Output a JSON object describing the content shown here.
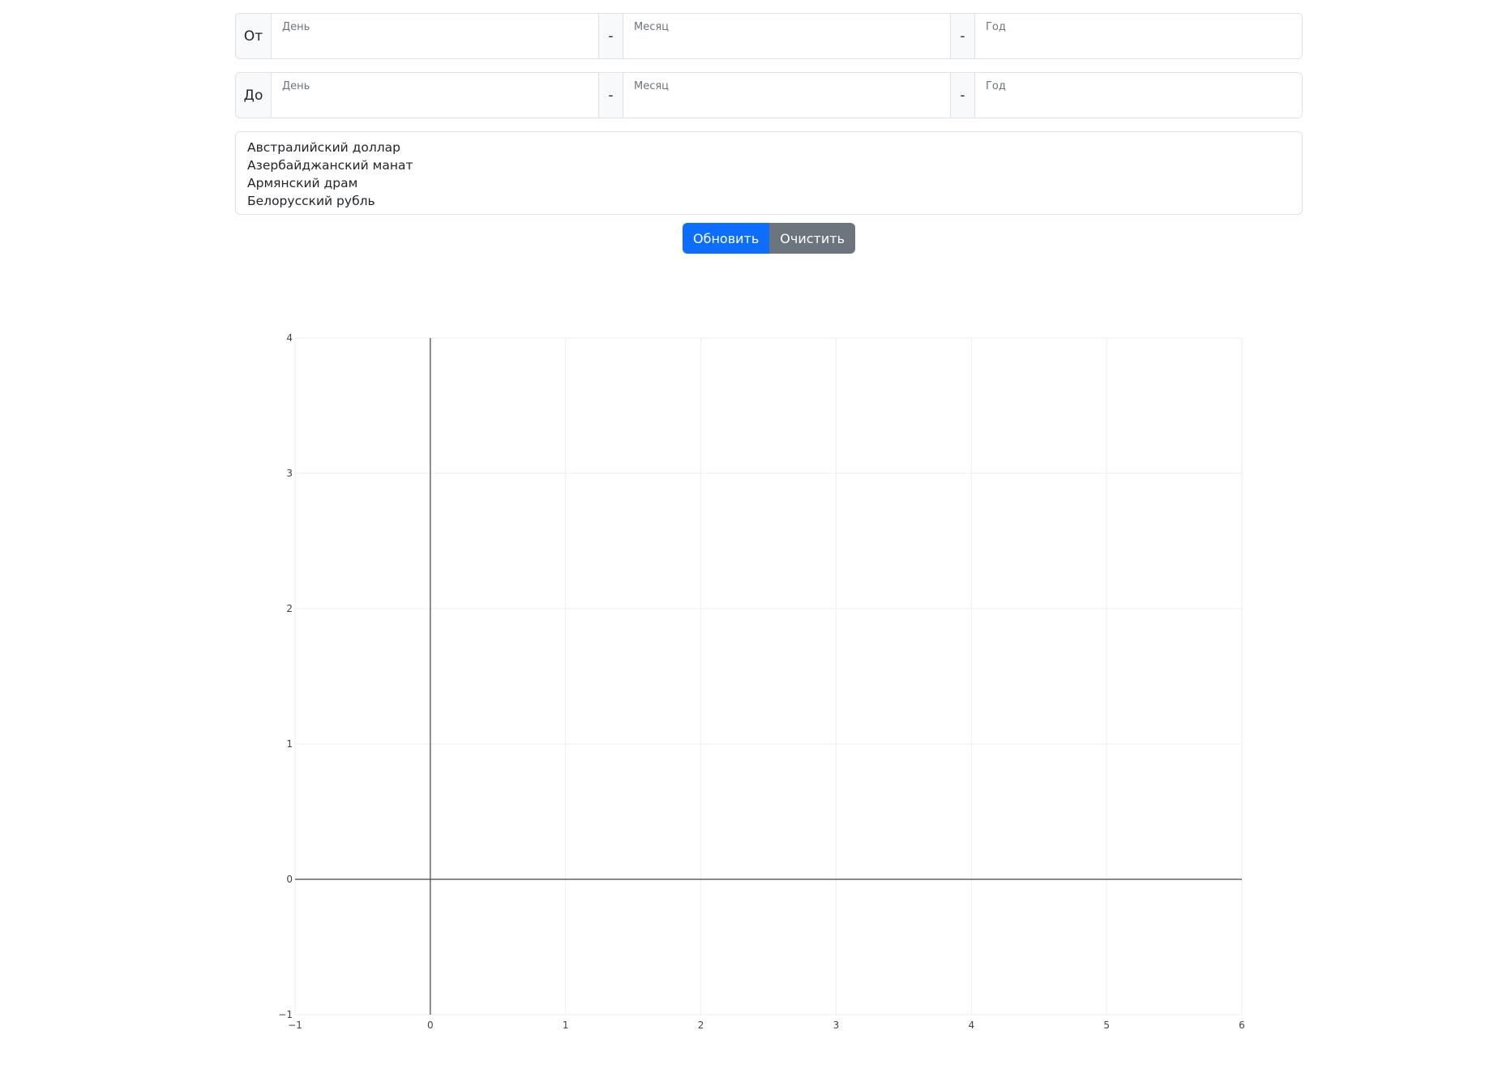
{
  "from_row": {
    "label": "От",
    "day_label": "День",
    "month_label": "Месяц",
    "year_label": "Год",
    "sep1": "-",
    "sep2": "-"
  },
  "to_row": {
    "label": "До",
    "day_label": "День",
    "month_label": "Месяц",
    "year_label": "Год",
    "sep1": "-",
    "sep2": "-"
  },
  "currencies": [
    "Австралийский доллар",
    "Азербайджанский манат",
    "Армянский драм",
    "Белорусский рубль"
  ],
  "buttons": {
    "update": "Обновить",
    "clear": "Очистить"
  },
  "colors": {
    "primary": "#0d6efd",
    "secondary": "#6c757d",
    "grid": "#eeeeee",
    "axis": "#444444"
  },
  "chart_data": {
    "type": "line",
    "series": [],
    "xlim": [
      -1,
      6
    ],
    "ylim": [
      -1,
      4
    ],
    "x_ticks": [
      -1,
      0,
      1,
      2,
      3,
      4,
      5,
      6
    ],
    "y_ticks": [
      -1,
      0,
      1,
      2,
      3,
      4
    ],
    "x_tick_labels": [
      "−1",
      "0",
      "1",
      "2",
      "3",
      "4",
      "5",
      "6"
    ],
    "y_tick_labels": [
      "−1",
      "0",
      "1",
      "2",
      "3",
      "4"
    ],
    "grid": true,
    "zero_lines": true
  }
}
